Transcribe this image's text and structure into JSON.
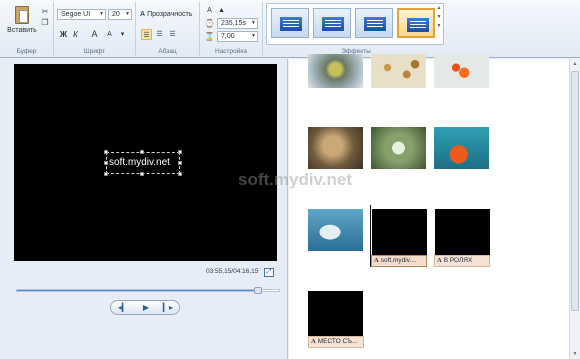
{
  "ribbon": {
    "clipboard": {
      "paste_label": "Вставить",
      "group_label": "Буфер"
    },
    "font": {
      "family": "Segoe UI",
      "size": "20",
      "group_label": "Шрифт",
      "bold": "Ж",
      "italic": "К",
      "grow": "A",
      "shrink": "A"
    },
    "paragraph": {
      "transparency_label": "Прозрачность",
      "group_label": "Абзац"
    },
    "settings": {
      "start_time": "235,15s",
      "duration": "7,00",
      "group_label": "Настройка"
    },
    "effects": {
      "group_label": "Эффекты"
    }
  },
  "preview": {
    "caption_text": "soft.mydiv.net",
    "time": "03:55,15/04:16,15",
    "progress": 0.92
  },
  "storyboard": {
    "watermark": "soft.mydiv.net",
    "captions": [
      {
        "icon": "A",
        "text": "soft.mydiv...."
      },
      {
        "icon": "A",
        "text": "В РОЛЯХ"
      },
      {
        "icon": "A",
        "text": "МЕСТО СЪ..."
      }
    ]
  }
}
